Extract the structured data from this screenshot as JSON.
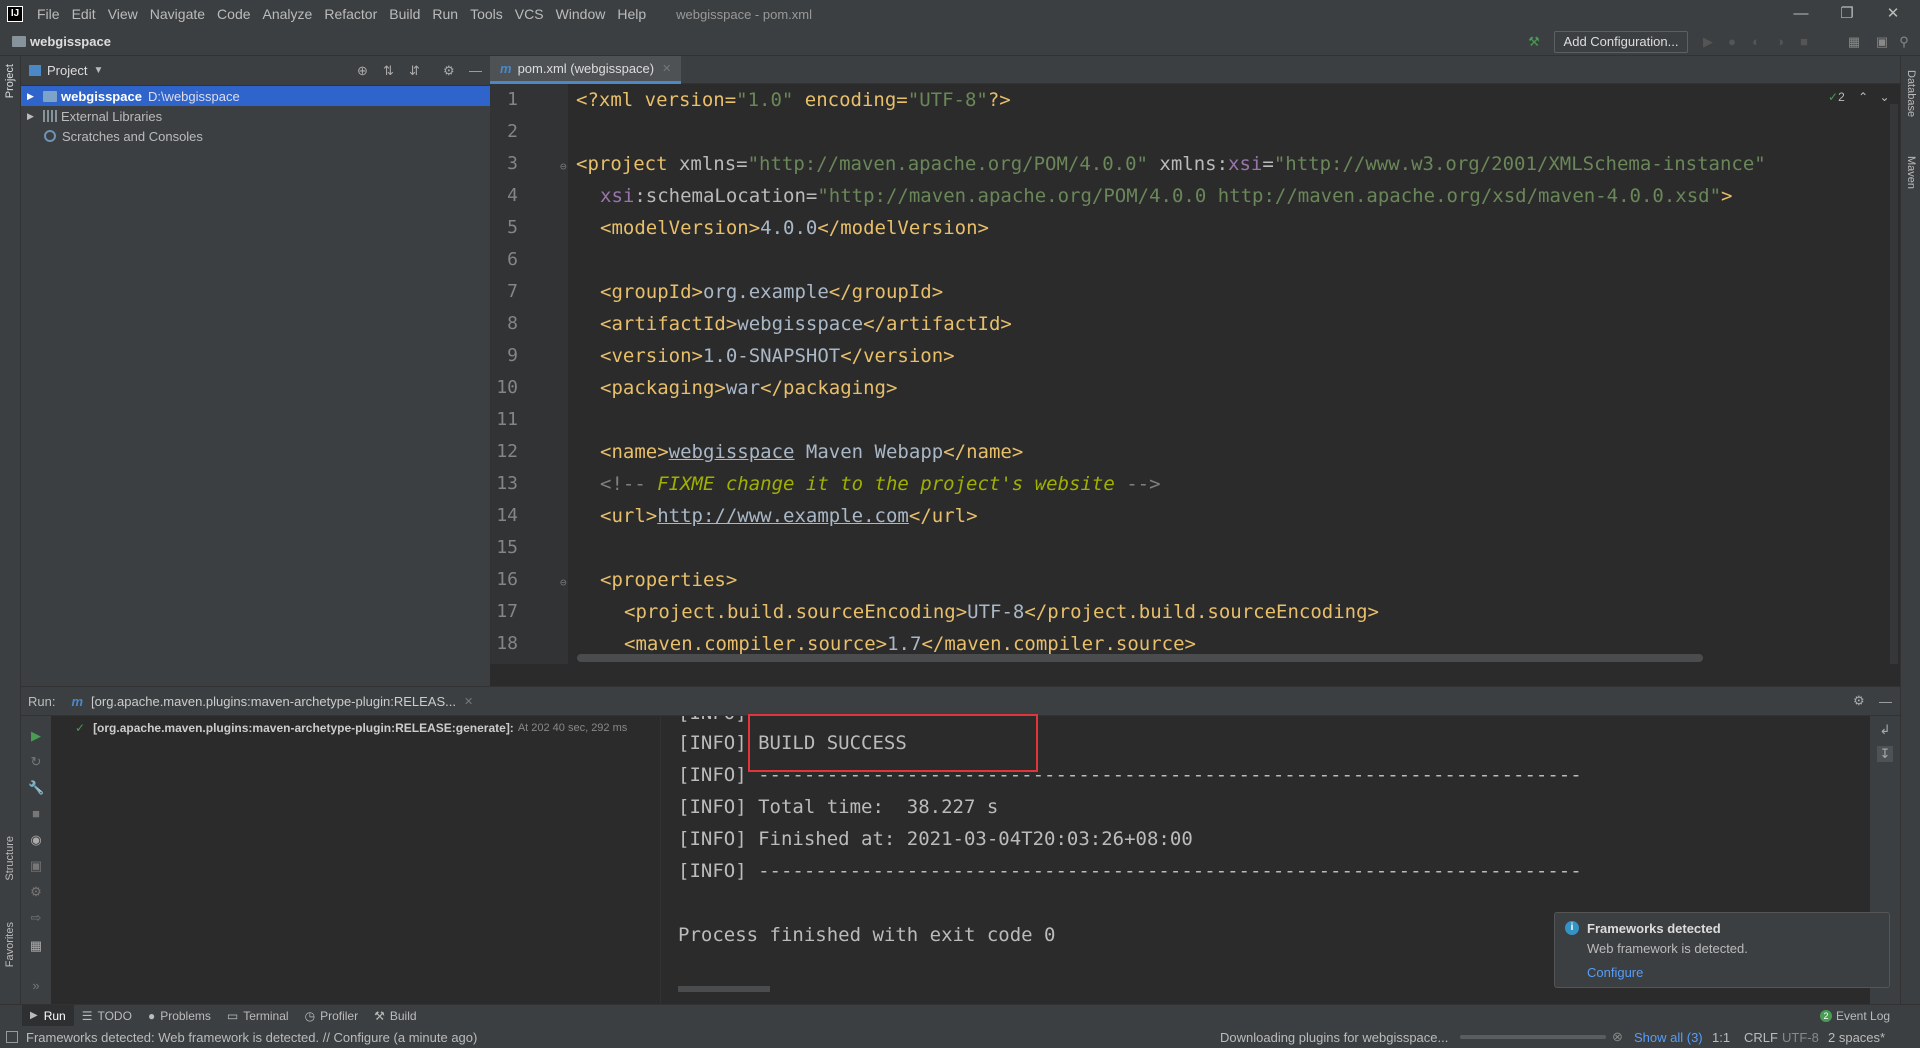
{
  "menubar": {
    "logo": "IJ",
    "items": [
      "File",
      "Edit",
      "View",
      "Navigate",
      "Code",
      "Analyze",
      "Refactor",
      "Build",
      "Run",
      "Tools",
      "VCS",
      "Window",
      "Help"
    ],
    "title": "webgisspace - pom.xml"
  },
  "navbar": {
    "project": "webgisspace",
    "add_configuration": "Add Configuration..."
  },
  "left_strip": {
    "project": "Project",
    "structure": "Structure",
    "favorites": "Favorites"
  },
  "right_strip": {
    "database": "Database",
    "maven": "Maven"
  },
  "project_panel": {
    "title": "Project",
    "tree": [
      {
        "name": "webgisspace",
        "path": "D:\\webgisspace"
      },
      {
        "name": "External Libraries"
      },
      {
        "name": "Scratches and Consoles"
      }
    ]
  },
  "editor": {
    "tab": "pom.xml (webgisspace)",
    "inspection_count": "2",
    "line_numbers": [
      "1",
      "2",
      "3",
      "4",
      "5",
      "6",
      "7",
      "8",
      "9",
      "10",
      "11",
      "12",
      "13",
      "14",
      "15",
      "16",
      "17",
      "18"
    ],
    "lines": {
      "l1": {
        "p1": "<?xml version=",
        "p2": "\"1.0\"",
        "p3": " encoding=",
        "p4": "\"UTF-8\"",
        "p5": "?>"
      },
      "l3": {
        "p1": "<project ",
        "p2": "xmlns=",
        "p3": "\"http://maven.apache.org/POM/4.0.0\"",
        "p4": " xmlns:",
        "p5": "xsi",
        "p6": "=",
        "p7": "\"http://www.w3.org/2001/XMLSchema-instance\""
      },
      "l4": {
        "p1": "xsi",
        "p2": ":schemaLocation=",
        "p3": "\"http://maven.apache.org/POM/4.0.0 http://maven.apache.org/xsd/maven-4.0.0.xsd\"",
        "p4": ">"
      },
      "l5": {
        "open": "<modelVersion>",
        "val": "4.0.0",
        "close": "</modelVersion>"
      },
      "l7": {
        "open": "<groupId>",
        "val": "org.example",
        "close": "</groupId>"
      },
      "l8": {
        "open": "<artifactId>",
        "val": "webgisspace",
        "close": "</artifactId>"
      },
      "l9": {
        "open": "<version>",
        "val": "1.0-SNAPSHOT",
        "close": "</version>"
      },
      "l10": {
        "open": "<packaging>",
        "val": "war",
        "close": "</packaging>"
      },
      "l12": {
        "open": "<name>",
        "val1": "webgisspace",
        "val2": " Maven Webapp",
        "close": "</name>"
      },
      "l13": {
        "open": "<!-- ",
        "text": "FIXME change it to the project's website",
        "close": " -->"
      },
      "l14": {
        "open": "<url>",
        "val": "http://www.example.com",
        "close": "</url>"
      },
      "l16": {
        "open": "<properties>"
      },
      "l17": {
        "open": "<project.build.sourceEncoding>",
        "val": "UTF-8",
        "close": "</project.build.sourceEncoding>"
      },
      "l18": {
        "open": "<maven.compiler.source>",
        "val": "1.7",
        "close": "</maven.compiler.source>"
      }
    }
  },
  "run_panel": {
    "label": "Run:",
    "tab": "[org.apache.maven.plugins:maven-archetype-plugin:RELEAS...",
    "tree_item": "[org.apache.maven.plugins:maven-archetype-plugin:RELEASE:generate]:",
    "tree_time": "At 202 40 sec, 292 ms",
    "console": [
      "[INFO] BUILD SUCCESS",
      "[INFO] ------------------------------------------------------------------------",
      "[INFO] Total time:  38.227 s",
      "[INFO] Finished at: 2021-03-04T20:03:26+08:00",
      "[INFO] ------------------------------------------------------------------------",
      "",
      "Process finished with exit code 0"
    ],
    "partial_top": "[INFO]"
  },
  "notification": {
    "title": "Frameworks detected",
    "body": "Web framework is detected.",
    "action": "Configure"
  },
  "bottom_tabs": [
    "Run",
    "TODO",
    "Problems",
    "Terminal",
    "Profiler",
    "Build"
  ],
  "event_log": "Event Log",
  "status": {
    "message": "Frameworks detected: Web framework is detected. // Configure (a minute ago)",
    "downloading": "Downloading plugins for webgisspace...",
    "show_all": "Show all (3)",
    "position": "1:1",
    "line_sep": "CRLF",
    "encoding": "UTF-8",
    "indent": "2 spaces*"
  },
  "colors": {
    "accent": "#2f65ca",
    "highlight_box": "#e0353a",
    "run_green": "#499c54"
  }
}
